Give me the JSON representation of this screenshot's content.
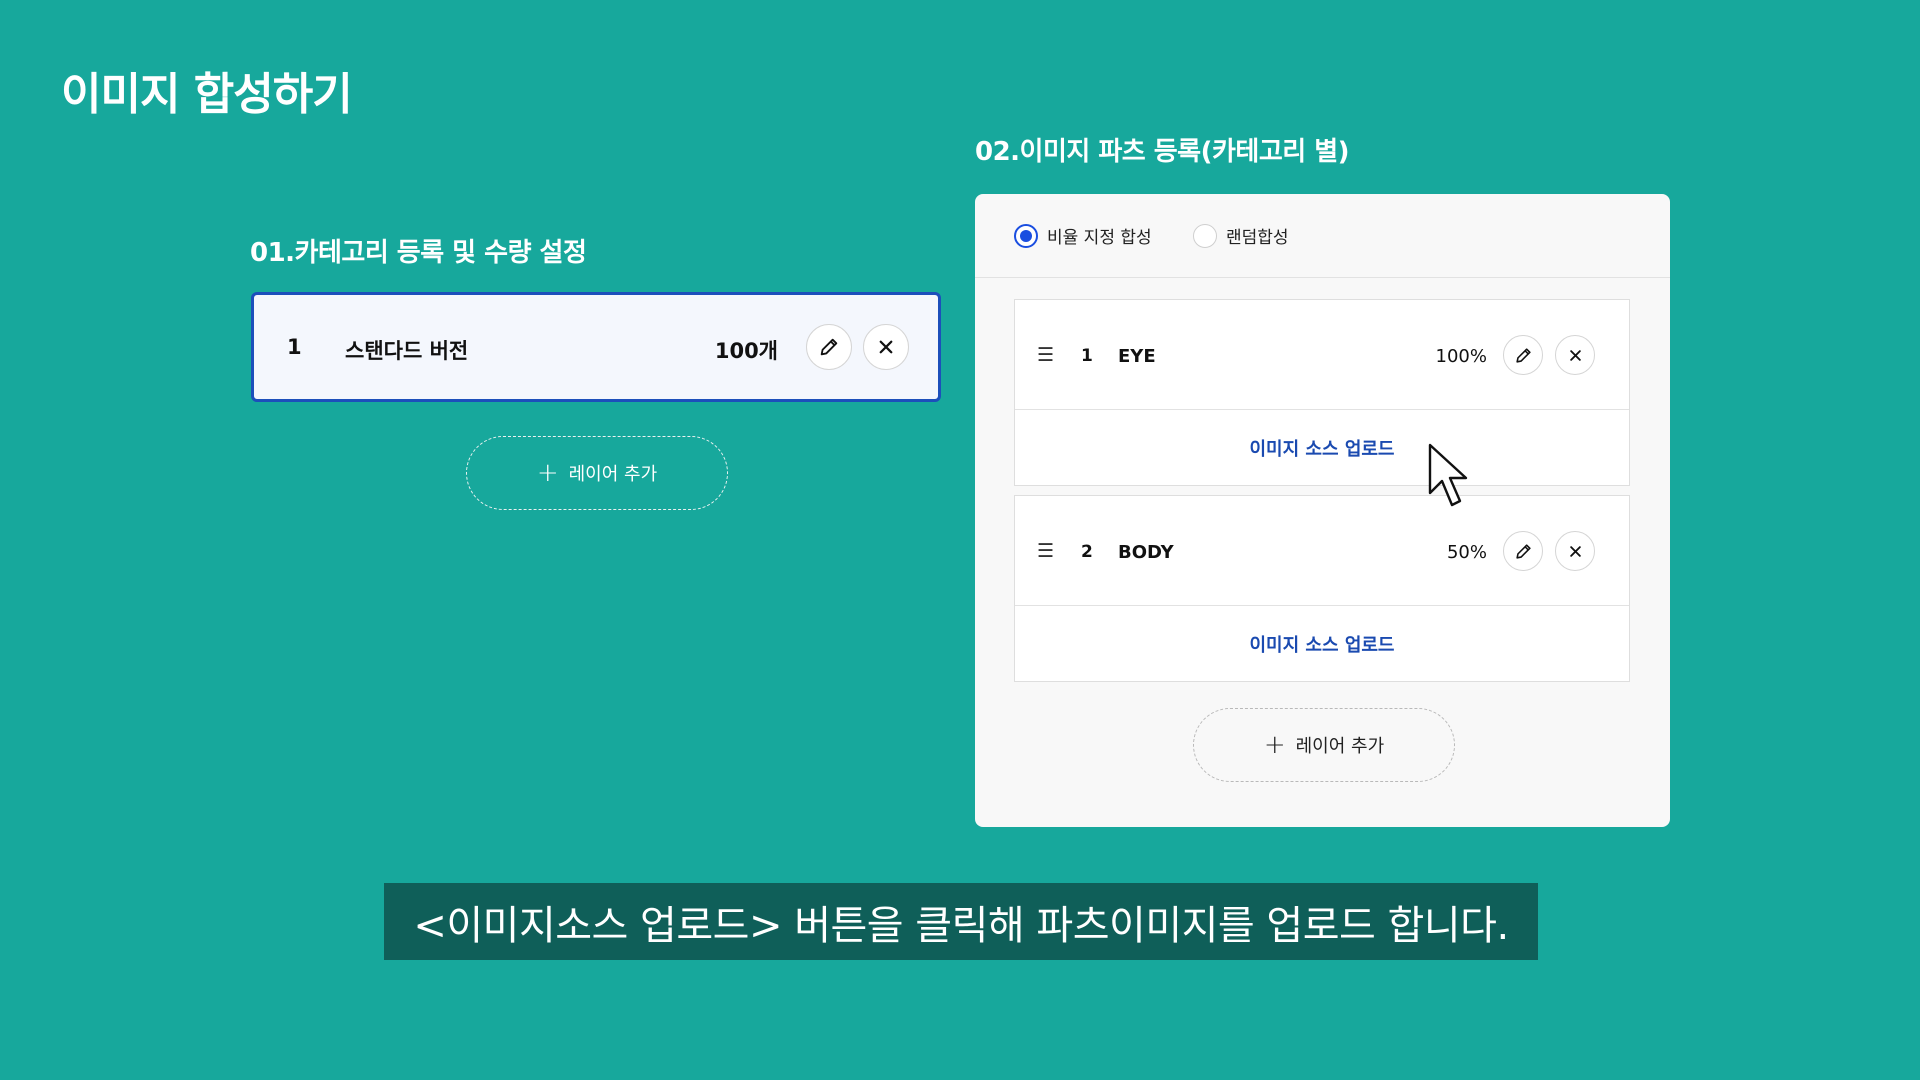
{
  "page_title": "이미지 합성하기",
  "section1": {
    "heading": "01.카테고리 등록 및 수량 설정",
    "category": {
      "index": "1",
      "name": "스탠다드 버전",
      "quantity": "100개"
    },
    "add_layer_label": "레이어 추가"
  },
  "section2": {
    "heading": "02.이미지 파츠 등록(카테고리 별)",
    "modes": [
      {
        "label": "비율 지정 합성",
        "selected": true
      },
      {
        "label": "랜덤합성",
        "selected": false
      }
    ],
    "parts": [
      {
        "index": "1",
        "name": "EYE",
        "percent": "100%",
        "upload_label": "이미지 소스 업로드"
      },
      {
        "index": "2",
        "name": "BODY",
        "percent": "50%",
        "upload_label": "이미지 소스 업로드"
      }
    ],
    "add_layer_label": "레이어 추가"
  },
  "caption": "<이미지소스 업로드> 버튼을 클릭해 파츠이미지를 업로드 합니다.",
  "colors": {
    "background": "#17a89c",
    "accent": "#1c4fbb",
    "caption_bg": "#0f5f59",
    "link": "#1a4ab0"
  },
  "icons": {
    "edit": "pencil-icon",
    "delete": "close-icon",
    "drag": "drag-handle-icon",
    "add": "plus-icon",
    "pointer": "mouse-cursor-icon"
  }
}
